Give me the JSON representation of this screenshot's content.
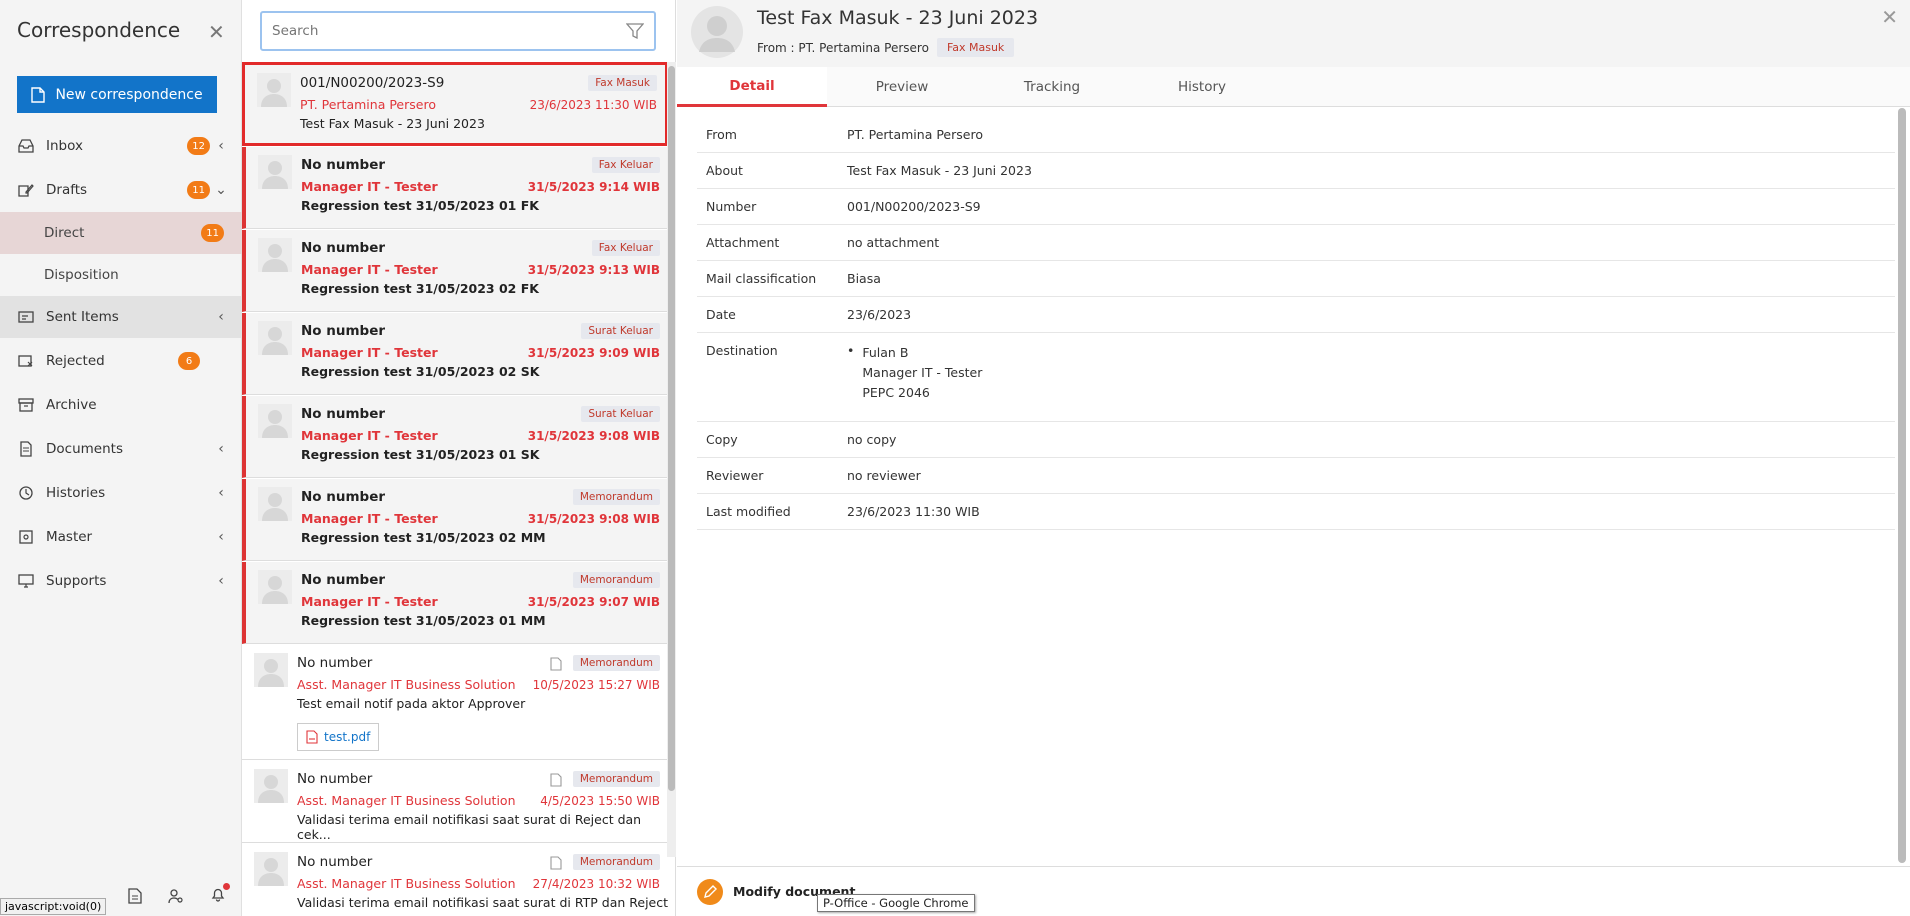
{
  "sidebar": {
    "title": "Correspondence",
    "new_button": "New correspondence",
    "items": [
      {
        "label": "Inbox",
        "badge": "12",
        "icon": "inbox-icon"
      },
      {
        "label": "Drafts",
        "badge": "11",
        "icon": "drafts-icon"
      },
      {
        "label": "Direct",
        "badge": "11"
      },
      {
        "label": "Disposition"
      },
      {
        "label": "Sent Items",
        "icon": "sent-icon"
      },
      {
        "label": "Rejected",
        "badge": "6",
        "icon": "rejected-icon"
      },
      {
        "label": "Archive",
        "icon": "archive-icon"
      },
      {
        "label": "Documents",
        "icon": "documents-icon"
      },
      {
        "label": "Histories",
        "icon": "history-icon"
      },
      {
        "label": "Master",
        "icon": "master-icon"
      },
      {
        "label": "Supports",
        "icon": "support-icon"
      }
    ]
  },
  "status_bar": "javascript:void(0)",
  "search": {
    "placeholder": "Search",
    "value": ""
  },
  "list": [
    {
      "number": "001/N00200/2023-S9",
      "from": "PT. Pertamina Persero",
      "subject": "Test Fax Masuk - 23 Juni 2023",
      "tag": "Fax Masuk",
      "date": "23/6/2023 11:30 WIB"
    },
    {
      "number": "No number",
      "from": "Manager IT - Tester",
      "subject": "Regression test 31/05/2023 01 FK",
      "tag": "Fax Keluar",
      "date": "31/5/2023 9:14 WIB"
    },
    {
      "number": "No number",
      "from": "Manager IT - Tester",
      "subject": "Regression test 31/05/2023 02 FK",
      "tag": "Fax Keluar",
      "date": "31/5/2023 9:13 WIB"
    },
    {
      "number": "No number",
      "from": "Manager IT - Tester",
      "subject": "Regression test 31/05/2023 02 SK",
      "tag": "Surat Keluar",
      "date": "31/5/2023 9:09 WIB"
    },
    {
      "number": "No number",
      "from": "Manager IT - Tester",
      "subject": "Regression test 31/05/2023 01 SK",
      "tag": "Surat Keluar",
      "date": "31/5/2023 9:08 WIB"
    },
    {
      "number": "No number",
      "from": "Manager IT - Tester",
      "subject": "Regression test 31/05/2023 02 MM",
      "tag": "Memorandum",
      "date": "31/5/2023 9:08 WIB"
    },
    {
      "number": "No number",
      "from": "Manager IT - Tester",
      "subject": "Regression test 31/05/2023 01 MM",
      "tag": "Memorandum",
      "date": "31/5/2023 9:07 WIB"
    },
    {
      "number": "No number",
      "from": "Asst. Manager IT Business Solution",
      "subject": "Test email notif pada aktor Approver",
      "tag": "Memorandum",
      "date": "10/5/2023 15:27 WIB",
      "attachment": "test.pdf"
    },
    {
      "number": "No number",
      "from": "Asst. Manager IT Business Solution",
      "subject": "Validasi terima email notifikasi saat surat di Reject dan cek...",
      "tag": "Memorandum",
      "date": "4/5/2023 15:50 WIB"
    },
    {
      "number": "No number",
      "from": "Asst. Manager IT Business Solution",
      "subject": "Validasi terima email notifikasi saat surat di RTP dan Reject",
      "tag": "Memorandum",
      "date": "27/4/2023 10:32 WIB"
    }
  ],
  "detail": {
    "title": "Test Fax Masuk - 23 Juni 2023",
    "from_line": "From : PT. Pertamina Persero",
    "tag": "Fax Masuk",
    "tabs": [
      "Detail",
      "Preview",
      "Tracking",
      "History"
    ],
    "rows": [
      {
        "key": "From",
        "value": "PT. Pertamina Persero"
      },
      {
        "key": "About",
        "value": "Test Fax Masuk - 23 Juni 2023"
      },
      {
        "key": "Number",
        "value": "001/N00200/2023-S9"
      },
      {
        "key": "Attachment",
        "value": "no attachment"
      },
      {
        "key": "Mail classification",
        "value": "Biasa"
      },
      {
        "key": "Date",
        "value": "23/6/2023"
      },
      {
        "key": "Destination",
        "dest_name": "Fulan B",
        "dest_role": "Manager IT - Tester",
        "dest_code": "PEPC 2046"
      },
      {
        "key": "Copy",
        "value": "no copy"
      },
      {
        "key": "Reviewer",
        "value": "no reviewer"
      },
      {
        "key": "Last modified",
        "value": "23/6/2023 11:30 WIB"
      }
    ],
    "modify_label": "Modify document",
    "tooltip": "P-Office - Google Chrome"
  },
  "colors": {
    "accent": "#1274c9",
    "badge": "#f27b16",
    "red": "#e0353a"
  }
}
